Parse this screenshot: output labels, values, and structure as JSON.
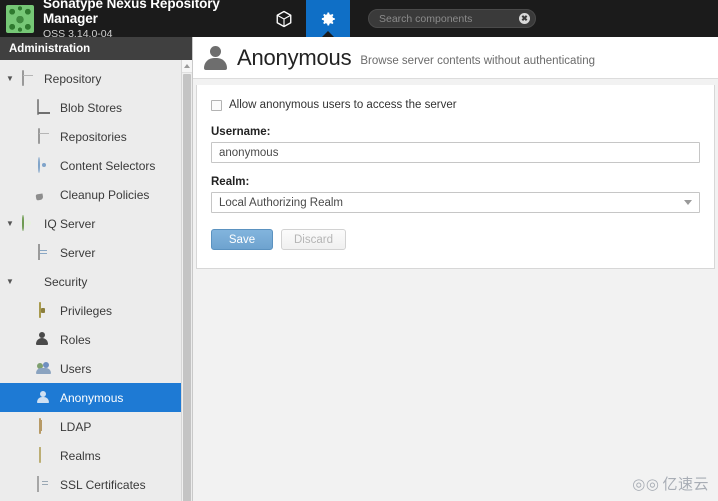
{
  "topbar": {
    "brand_title": "Sonatype Nexus Repository Manager",
    "brand_subtitle": "OSS 3.14.0-04",
    "logo_icon": "nexus-logo",
    "tabs": [
      {
        "id": "browse",
        "icon": "cube-icon",
        "active": false
      },
      {
        "id": "administration",
        "icon": "gear-icon",
        "active": true
      }
    ],
    "search": {
      "placeholder": "Search components",
      "value": "",
      "clear_glyph": "✖"
    }
  },
  "sidebar": {
    "header": "Administration",
    "items": [
      {
        "label": "Repository",
        "icon": "database-icon",
        "level": "group",
        "caret": "▼",
        "selected": false
      },
      {
        "label": "Blob Stores",
        "icon": "blob-store-icon",
        "level": "child",
        "selected": false
      },
      {
        "label": "Repositories",
        "icon": "repositories-icon",
        "level": "child",
        "selected": false
      },
      {
        "label": "Content Selectors",
        "icon": "content-selector-icon",
        "level": "child",
        "selected": false
      },
      {
        "label": "Cleanup Policies",
        "icon": "broom-icon",
        "level": "child",
        "selected": false
      },
      {
        "label": "IQ Server",
        "icon": "iq-server-icon",
        "level": "group",
        "caret": "▼",
        "selected": false
      },
      {
        "label": "Server",
        "icon": "server-icon",
        "level": "child",
        "selected": false
      },
      {
        "label": "Security",
        "icon": "security-icon",
        "level": "group",
        "caret": "▼",
        "selected": false
      },
      {
        "label": "Privileges",
        "icon": "privilege-icon",
        "level": "child",
        "selected": false
      },
      {
        "label": "Roles",
        "icon": "role-icon",
        "level": "child",
        "selected": false
      },
      {
        "label": "Users",
        "icon": "users-icon",
        "level": "child",
        "selected": false
      },
      {
        "label": "Anonymous",
        "icon": "anonymous-icon",
        "level": "child",
        "selected": true
      },
      {
        "label": "LDAP",
        "icon": "ldap-icon",
        "level": "child",
        "selected": false
      },
      {
        "label": "Realms",
        "icon": "realm-icon",
        "level": "child",
        "selected": false
      },
      {
        "label": "SSL Certificates",
        "icon": "ssl-certificate-icon",
        "level": "child",
        "selected": false
      }
    ]
  },
  "page": {
    "avatar_icon": "user-avatar-icon",
    "title": "Anonymous",
    "subtitle": "Browse server contents without authenticating",
    "form": {
      "allow_anonymous_label": "Allow anonymous users to access the server",
      "allow_anonymous_checked": false,
      "username_label": "Username:",
      "username_value": "anonymous",
      "realm_label": "Realm:",
      "realm_value": "Local Authorizing Realm",
      "realm_options": [
        "Local Authorizing Realm"
      ],
      "save_label": "Save",
      "discard_label": "Discard",
      "discard_disabled": true
    }
  },
  "watermark": {
    "mark": "◎◎",
    "text": "亿速云"
  },
  "colors": {
    "topbar_bg": "#1b1b1b",
    "accent_blue": "#0f6fc6",
    "selected_blue": "#1e7ad4",
    "sidebar_bg": "#ececec",
    "admin_header_bg": "#404040",
    "save_button": "#6ea3cf"
  }
}
